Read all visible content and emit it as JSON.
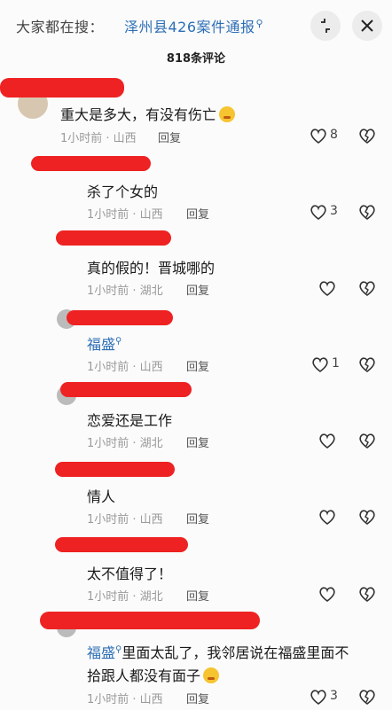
{
  "header": {
    "search_prefix": "大家都在搜：",
    "search_topic": "泽州县426案件通报",
    "comment_count": "818条评论"
  },
  "icons": {
    "search_glyph": "search-icon",
    "collapse": "collapse-icon",
    "close": "close-icon",
    "like": "heart-outline-icon",
    "dislike": "broken-heart-icon"
  },
  "colors": {
    "link": "#2d6fb6",
    "redaction": "#ee2222"
  },
  "comments": [
    {
      "text": "重大是多大，有没有伤亡",
      "time": "1小时前 · 山西",
      "reply": "回复",
      "likes": "8",
      "emoji": "crying-face"
    },
    {
      "text": "杀了个女的",
      "time": "1小时前 · 山西",
      "reply": "回复",
      "likes": "3"
    },
    {
      "text": "真的假的！晋城哪的",
      "time": "1小时前 · 湖北",
      "reply": "回复",
      "likes": ""
    },
    {
      "link": "福盛",
      "time": "1小时前 · 山西",
      "reply": "回复",
      "likes": "1"
    },
    {
      "text": "恋爱还是工作",
      "time": "1小时前 · 湖北",
      "reply": "回复",
      "likes": ""
    },
    {
      "text": "情人",
      "time": "1小时前 · 山西",
      "reply": "回复",
      "likes": ""
    },
    {
      "text": "太不值得了！",
      "time": "1小时前 · 湖北",
      "reply": "回复",
      "likes": ""
    },
    {
      "link": "福盛",
      "text_line1": "里面太乱了，我邻居说在福盛里面不",
      "text_line2": "拾跟人都没有面子",
      "time": "1小时前 · 山西",
      "reply": "回复",
      "likes": "3",
      "emoji": "laughing-crying-face"
    }
  ]
}
